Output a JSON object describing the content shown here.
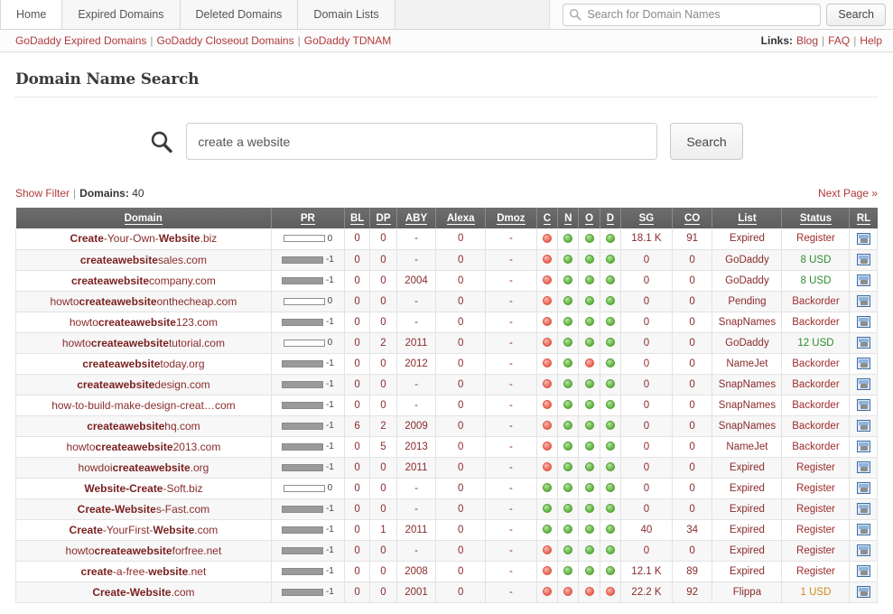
{
  "nav": {
    "tabs": [
      {
        "label": "Home",
        "active": false
      },
      {
        "label": "Expired Domains",
        "active": false
      },
      {
        "label": "Deleted Domains",
        "active": false
      },
      {
        "label": "Domain Lists",
        "active": false
      }
    ],
    "search_placeholder": "Search for Domain Names",
    "search_value": "",
    "search_button": "Search",
    "search_icon": "magnifier-icon"
  },
  "linksbar": {
    "left_links": [
      "GoDaddy Expired Domains",
      "GoDaddy Closeout Domains",
      "GoDaddy TDNAM"
    ],
    "separator": "|",
    "right_label": "Links:",
    "right_links": [
      "Blog",
      "FAQ",
      "Help"
    ]
  },
  "page": {
    "title": "Domain Name Search"
  },
  "big_search": {
    "icon": "magnifier-icon",
    "value": "create a website",
    "placeholder": "",
    "button": "Search"
  },
  "filter": {
    "show_filter": "Show Filter",
    "separator": "|",
    "domains_label": "Domains:",
    "domains_count": "40",
    "next_page": "Next Page »"
  },
  "table": {
    "columns": [
      "Domain",
      "PR",
      "BL",
      "DP",
      "ABY",
      "Alexa",
      "Dmoz",
      "C",
      "N",
      "O",
      "D",
      "SG",
      "CO",
      "List",
      "Status",
      "RL"
    ],
    "rows": [
      {
        "domain_parts": [
          {
            "t": "Create",
            "b": true
          },
          {
            "t": "-Your-Own-",
            "b": false
          },
          {
            "t": "Website",
            "b": true
          },
          {
            "t": ".biz",
            "b": false
          }
        ],
        "pr_bar": "empty",
        "pr": "0",
        "bl": "0",
        "dp": "0",
        "aby": "-",
        "alexa": "0",
        "dmoz": "-",
        "c": "red",
        "n": "green",
        "o": "green",
        "d": "green",
        "sg": "18.1 K",
        "co": "91",
        "list": "Expired",
        "status": "Register",
        "status_color": "red",
        "rl": "monitor-icon"
      },
      {
        "domain_parts": [
          {
            "t": "createawebsite",
            "b": true
          },
          {
            "t": "sales.com",
            "b": false
          }
        ],
        "pr_bar": "filled",
        "pr": "-1",
        "bl": "0",
        "dp": "0",
        "aby": "-",
        "alexa": "0",
        "dmoz": "-",
        "c": "red",
        "n": "green",
        "o": "green",
        "d": "green",
        "sg": "0",
        "co": "0",
        "list": "GoDaddy",
        "status": "8 USD",
        "status_color": "green",
        "rl": "monitor-icon"
      },
      {
        "domain_parts": [
          {
            "t": "createawebsite",
            "b": true
          },
          {
            "t": "company.com",
            "b": false
          }
        ],
        "pr_bar": "filled",
        "pr": "-1",
        "bl": "0",
        "dp": "0",
        "aby": "2004",
        "alexa": "0",
        "dmoz": "-",
        "c": "red",
        "n": "green",
        "o": "green",
        "d": "green",
        "sg": "0",
        "co": "0",
        "list": "GoDaddy",
        "status": "8 USD",
        "status_color": "green",
        "rl": "monitor-icon"
      },
      {
        "domain_parts": [
          {
            "t": "howto",
            "b": false
          },
          {
            "t": "createawebsite",
            "b": true
          },
          {
            "t": "onthecheap.com",
            "b": false
          }
        ],
        "pr_bar": "empty",
        "pr": "0",
        "bl": "0",
        "dp": "0",
        "aby": "-",
        "alexa": "0",
        "dmoz": "-",
        "c": "red",
        "n": "green",
        "o": "green",
        "d": "green",
        "sg": "0",
        "co": "0",
        "list": "Pending",
        "status": "Backorder",
        "status_color": "red",
        "rl": "monitor-icon"
      },
      {
        "domain_parts": [
          {
            "t": "howto",
            "b": false
          },
          {
            "t": "createawebsite",
            "b": true
          },
          {
            "t": "123.com",
            "b": false
          }
        ],
        "pr_bar": "filled",
        "pr": "-1",
        "bl": "0",
        "dp": "0",
        "aby": "-",
        "alexa": "0",
        "dmoz": "-",
        "c": "red",
        "n": "green",
        "o": "green",
        "d": "green",
        "sg": "0",
        "co": "0",
        "list": "SnapNames",
        "status": "Backorder",
        "status_color": "red",
        "rl": "monitor-icon"
      },
      {
        "domain_parts": [
          {
            "t": "howto",
            "b": false
          },
          {
            "t": "createawebsite",
            "b": true
          },
          {
            "t": "tutorial.com",
            "b": false
          }
        ],
        "pr_bar": "empty",
        "pr": "0",
        "bl": "0",
        "dp": "2",
        "aby": "2011",
        "alexa": "0",
        "dmoz": "-",
        "c": "red",
        "n": "green",
        "o": "green",
        "d": "green",
        "sg": "0",
        "co": "0",
        "list": "GoDaddy",
        "status": "12 USD",
        "status_color": "green",
        "rl": "monitor-icon"
      },
      {
        "domain_parts": [
          {
            "t": "createawebsite",
            "b": true
          },
          {
            "t": "today.org",
            "b": false
          }
        ],
        "pr_bar": "filled",
        "pr": "-1",
        "bl": "0",
        "dp": "0",
        "aby": "2012",
        "alexa": "0",
        "dmoz": "-",
        "c": "red",
        "n": "green",
        "o": "red",
        "d": "green",
        "sg": "0",
        "co": "0",
        "list": "NameJet",
        "status": "Backorder",
        "status_color": "red",
        "rl": "monitor-icon"
      },
      {
        "domain_parts": [
          {
            "t": "createawebsite",
            "b": true
          },
          {
            "t": "design.com",
            "b": false
          }
        ],
        "pr_bar": "filled",
        "pr": "-1",
        "bl": "0",
        "dp": "0",
        "aby": "-",
        "alexa": "0",
        "dmoz": "-",
        "c": "red",
        "n": "green",
        "o": "green",
        "d": "green",
        "sg": "0",
        "co": "0",
        "list": "SnapNames",
        "status": "Backorder",
        "status_color": "red",
        "rl": "monitor-icon"
      },
      {
        "domain_parts": [
          {
            "t": "how-to-build-make-design-creat…com",
            "b": false
          }
        ],
        "pr_bar": "filled",
        "pr": "-1",
        "bl": "0",
        "dp": "0",
        "aby": "-",
        "alexa": "0",
        "dmoz": "-",
        "c": "red",
        "n": "green",
        "o": "green",
        "d": "green",
        "sg": "0",
        "co": "0",
        "list": "SnapNames",
        "status": "Backorder",
        "status_color": "red",
        "rl": "monitor-icon"
      },
      {
        "domain_parts": [
          {
            "t": "createawebsite",
            "b": true
          },
          {
            "t": "hq.com",
            "b": false
          }
        ],
        "pr_bar": "filled",
        "pr": "-1",
        "bl": "6",
        "dp": "2",
        "aby": "2009",
        "alexa": "0",
        "dmoz": "-",
        "c": "red",
        "n": "green",
        "o": "green",
        "d": "green",
        "sg": "0",
        "co": "0",
        "list": "SnapNames",
        "status": "Backorder",
        "status_color": "red",
        "rl": "monitor-icon"
      },
      {
        "domain_parts": [
          {
            "t": "howto",
            "b": false
          },
          {
            "t": "createawebsite",
            "b": true
          },
          {
            "t": "2013.com",
            "b": false
          }
        ],
        "pr_bar": "filled",
        "pr": "-1",
        "bl": "0",
        "dp": "5",
        "aby": "2013",
        "alexa": "0",
        "dmoz": "-",
        "c": "red",
        "n": "green",
        "o": "green",
        "d": "green",
        "sg": "0",
        "co": "0",
        "list": "NameJet",
        "status": "Backorder",
        "status_color": "red",
        "rl": "monitor-icon"
      },
      {
        "domain_parts": [
          {
            "t": "howdoi",
            "b": false
          },
          {
            "t": "createawebsite",
            "b": true
          },
          {
            "t": ".org",
            "b": false
          }
        ],
        "pr_bar": "filled",
        "pr": "-1",
        "bl": "0",
        "dp": "0",
        "aby": "2011",
        "alexa": "0",
        "dmoz": "-",
        "c": "red",
        "n": "green",
        "o": "green",
        "d": "green",
        "sg": "0",
        "co": "0",
        "list": "Expired",
        "status": "Register",
        "status_color": "red",
        "rl": "monitor-icon"
      },
      {
        "domain_parts": [
          {
            "t": "Website-Create",
            "b": true
          },
          {
            "t": "-Soft.biz",
            "b": false
          }
        ],
        "pr_bar": "empty",
        "pr": "0",
        "bl": "0",
        "dp": "0",
        "aby": "-",
        "alexa": "0",
        "dmoz": "-",
        "c": "green",
        "n": "green",
        "o": "green",
        "d": "green",
        "sg": "0",
        "co": "0",
        "list": "Expired",
        "status": "Register",
        "status_color": "red",
        "rl": "monitor-icon"
      },
      {
        "domain_parts": [
          {
            "t": "Create-Website",
            "b": true
          },
          {
            "t": "s-Fast.com",
            "b": false
          }
        ],
        "pr_bar": "filled",
        "pr": "-1",
        "bl": "0",
        "dp": "0",
        "aby": "-",
        "alexa": "0",
        "dmoz": "-",
        "c": "green",
        "n": "green",
        "o": "green",
        "d": "green",
        "sg": "0",
        "co": "0",
        "list": "Expired",
        "status": "Register",
        "status_color": "red",
        "rl": "monitor-icon"
      },
      {
        "domain_parts": [
          {
            "t": "Create",
            "b": true
          },
          {
            "t": "-YourFirst-",
            "b": false
          },
          {
            "t": "Website",
            "b": true
          },
          {
            "t": ".com",
            "b": false
          }
        ],
        "pr_bar": "filled",
        "pr": "-1",
        "bl": "0",
        "dp": "1",
        "aby": "2011",
        "alexa": "0",
        "dmoz": "-",
        "c": "green",
        "n": "green",
        "o": "green",
        "d": "green",
        "sg": "40",
        "co": "34",
        "list": "Expired",
        "status": "Register",
        "status_color": "red",
        "rl": "monitor-icon"
      },
      {
        "domain_parts": [
          {
            "t": "howto",
            "b": false
          },
          {
            "t": "createawebsite",
            "b": true
          },
          {
            "t": "forfree.net",
            "b": false
          }
        ],
        "pr_bar": "filled",
        "pr": "-1",
        "bl": "0",
        "dp": "0",
        "aby": "-",
        "alexa": "0",
        "dmoz": "-",
        "c": "red",
        "n": "green",
        "o": "green",
        "d": "green",
        "sg": "0",
        "co": "0",
        "list": "Expired",
        "status": "Register",
        "status_color": "red",
        "rl": "monitor-icon"
      },
      {
        "domain_parts": [
          {
            "t": "create",
            "b": true
          },
          {
            "t": "-a-free-",
            "b": false
          },
          {
            "t": "website",
            "b": true
          },
          {
            "t": ".net",
            "b": false
          }
        ],
        "pr_bar": "filled",
        "pr": "-1",
        "bl": "0",
        "dp": "0",
        "aby": "2008",
        "alexa": "0",
        "dmoz": "-",
        "c": "red",
        "n": "green",
        "o": "green",
        "d": "green",
        "sg": "12.1 K",
        "co": "89",
        "list": "Expired",
        "status": "Register",
        "status_color": "red",
        "rl": "monitor-icon"
      },
      {
        "domain_parts": [
          {
            "t": "Create-Website",
            "b": true
          },
          {
            "t": ".com",
            "b": false
          }
        ],
        "pr_bar": "filled",
        "pr": "-1",
        "bl": "0",
        "dp": "0",
        "aby": "2001",
        "alexa": "0",
        "dmoz": "-",
        "c": "red",
        "n": "red",
        "o": "red",
        "d": "red",
        "sg": "22.2 K",
        "co": "92",
        "list": "Flippa",
        "status": "1 USD",
        "status_color": "gold",
        "rl": "monitor-icon"
      }
    ]
  },
  "colors": {
    "link_red": "#b03a3a",
    "domain_red": "#8a2b2b",
    "header_gray": "#6e6e6e",
    "status_green": "#2e8b2e",
    "status_gold": "#d38b1a",
    "dot_green": "#4f9c33",
    "dot_red": "#d9503f"
  }
}
